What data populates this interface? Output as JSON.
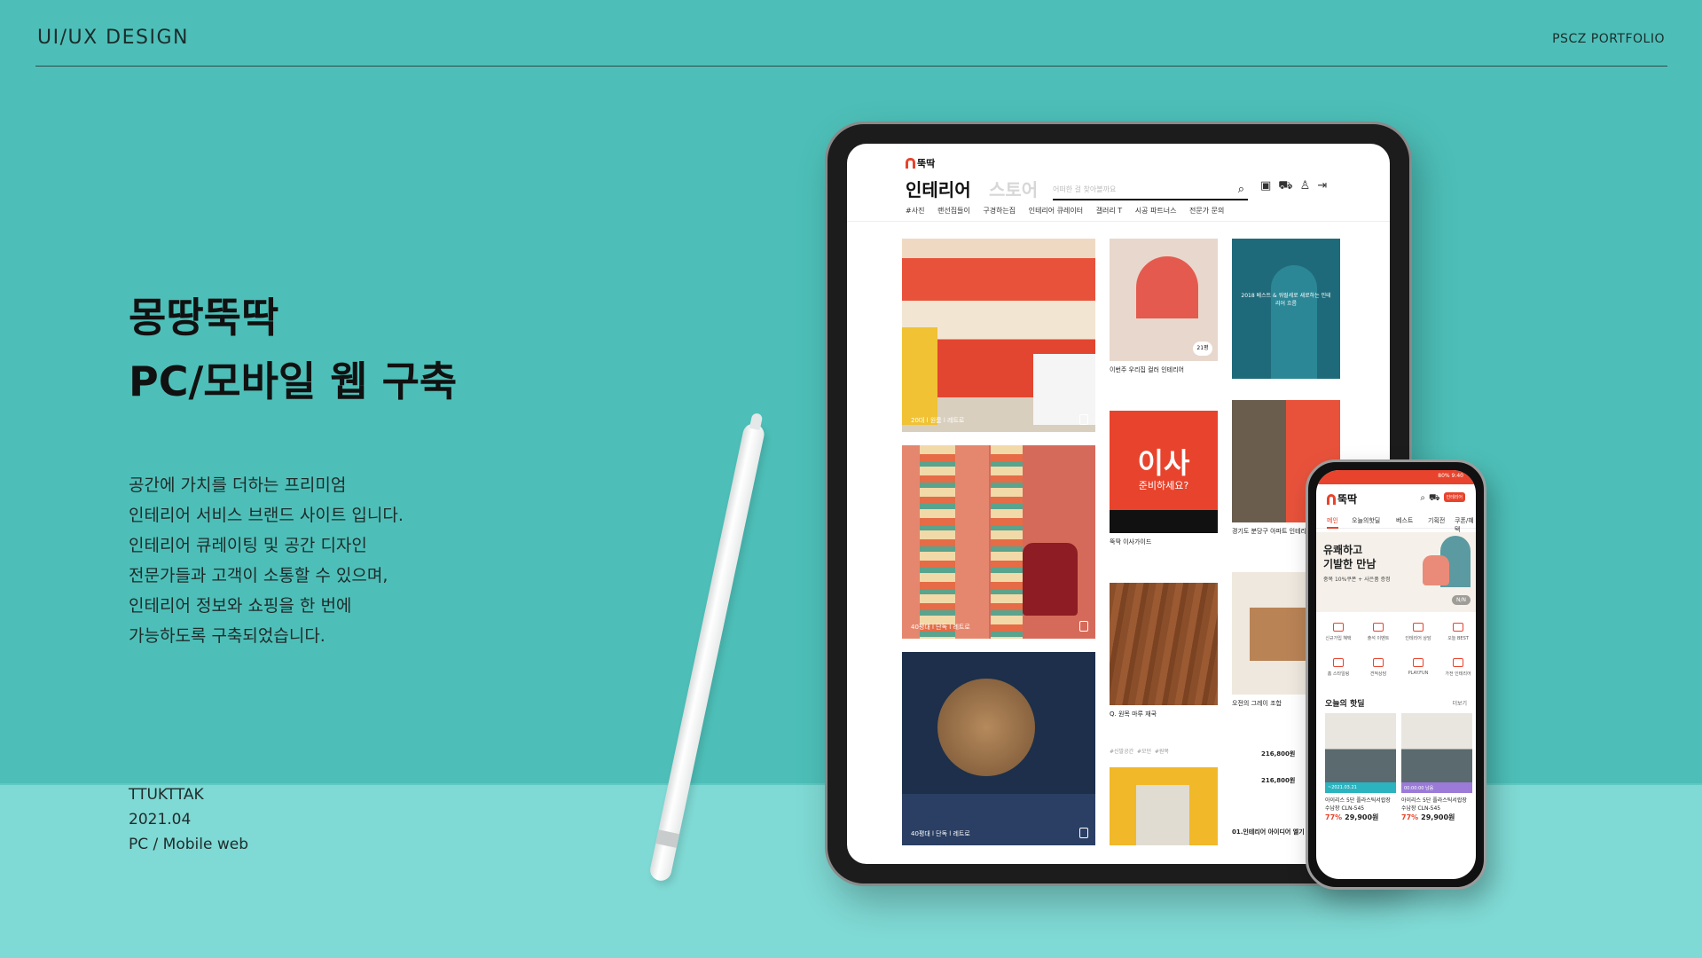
{
  "header": {
    "title": "UI/UX DESIGN",
    "right": "PSCZ PORTFOLIO"
  },
  "hero": {
    "line1": "몽땅뚝딱",
    "line2": "PC/모바일 웹 구축"
  },
  "description": [
    "공간에 가치를 더하는 프리미엄",
    "인테리어 서비스 브랜드 사이트 입니다.",
    "인테리어 큐레이팅 및 공간 디자인",
    "전문가들과 고객이 소통할 수 있으며,",
    "인테리어 정보와 쇼핑을 한 번에",
    "가능하도록 구축되었습니다."
  ],
  "meta": {
    "brand": "TTUKTTAK",
    "date": "2021.04",
    "platform": "PC / Mobile web"
  },
  "tablet": {
    "logo": "뚝딱",
    "nav_interior": "인테리어",
    "nav_store": "스토어",
    "search_placeholder": "어떠한 걸 찾아볼까요",
    "menu": [
      "#사진",
      "랜선집들이",
      "구경하는집",
      "인테리어 큐레이터",
      "갤러리 T",
      "시공 파트너스",
      "전문가 문의"
    ],
    "captions": {
      "c1": "20대 l 원룸 l 레트로",
      "c2": "40평대 l 단독 l 레트로",
      "c3": "40평대 l 단독 l 레트로"
    },
    "card_titles": {
      "t1": "이번주 우리집 컬러 인테리어",
      "t2": "뚝딱 이사가이드",
      "t3": "Q. 원목 마루 재국",
      "t4": "경기도 분당구 아파트 인테리어",
      "t5": "오전의 그레이 조합",
      "t6": "01.인테리어 아이디어 엘기"
    },
    "event_text": "2018 베스트 & 워럴세로 새로하는 인테리어 흐름",
    "move_title": "이사",
    "move_sub": "준비하세요?",
    "badge_21": "21평",
    "tags": [
      "#신발공간",
      "#모던",
      "#원목"
    ],
    "prices": [
      "216,800원",
      "216,800원"
    ]
  },
  "phone": {
    "status": "80% 9:40",
    "logo": "뚝딱",
    "badge": "인테리어",
    "tabs": [
      "메인",
      "오늘의핫딜",
      "베스트",
      "기획전",
      "쿠폰/혜택"
    ],
    "hero_line1": "유쾌하고",
    "hero_line2": "기발한 만남",
    "hero_sub": "중복 10%쿠폰 + 사은품 증정",
    "pager": "N/N",
    "categories": [
      "신규가입 혜택",
      "출석 이벤트",
      "인테리어 상담",
      "오늘 BEST",
      "홈 스타일링",
      "견적상담",
      "PLAY.FUN",
      "가전 인테리어"
    ],
    "hot_title": "오늘의 핫딜",
    "more": "더보기",
    "cards": [
      {
        "tag": "~2021.03.21",
        "name": "아이리스 5단 플라스틱서랍장 수납장 CLN-545",
        "pct": "77%",
        "price": "29,900원"
      },
      {
        "tag": "00:00:00 남음",
        "name": "아이리스 5단 플라스틱서랍장 수납장 CLN-545",
        "pct": "77%",
        "price": "29,900원"
      }
    ]
  },
  "colors": {
    "background": "#4dbfb8",
    "floor": "#7fd9d4",
    "accent": "#e8432c"
  }
}
